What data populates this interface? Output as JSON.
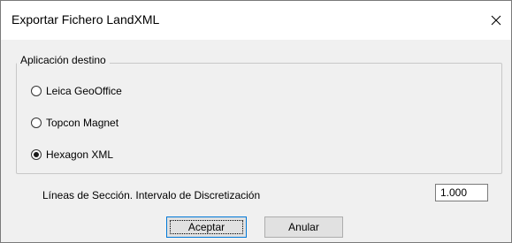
{
  "window": {
    "title": "Exportar Fichero LandXML",
    "close_icon": "close-icon"
  },
  "group": {
    "legend": "Aplicación destino",
    "options": [
      {
        "label": "Leica GeoOffice",
        "checked": false
      },
      {
        "label": "Topcon Magnet",
        "checked": false
      },
      {
        "label": "Hexagon XML",
        "checked": true
      }
    ]
  },
  "interval": {
    "label": "Líneas de Sección. Intervalo de Discretización",
    "value": "1.000"
  },
  "buttons": {
    "accept": "Aceptar",
    "cancel": "Anular"
  },
  "colors": {
    "titlebar": "#ffffff",
    "background": "#f0f0f0",
    "default_button_border": "#0078d7"
  }
}
